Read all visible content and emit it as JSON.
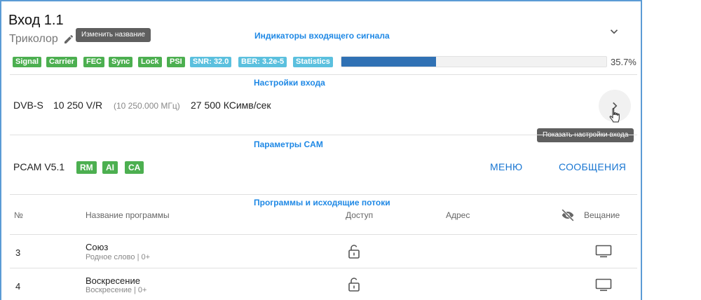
{
  "header": {
    "title": "Вход 1.1",
    "subtitle": "Триколор",
    "rename_tooltip": "Изменить название",
    "icons": {
      "edit": "pencil-icon",
      "expand": "chevron-down-icon"
    }
  },
  "annotations": {
    "signal_indicators": "Индикаторы входящего сигнала",
    "input_settings": "Настройки входа",
    "cam_params": "Параметры CAM",
    "programs": "Программы и исходящие потоки"
  },
  "signal": {
    "badges": [
      {
        "label": "Signal",
        "color": "#4caf50"
      },
      {
        "label": "Carrier",
        "color": "#4caf50"
      },
      {
        "label": "FEC",
        "color": "#4caf50"
      },
      {
        "label": "Sync",
        "color": "#4caf50"
      },
      {
        "label": "Lock",
        "color": "#4caf50"
      },
      {
        "label": "PSI",
        "color": "#4caf50"
      },
      {
        "label": "SNR: 32.0",
        "color": "#5bc0de"
      },
      {
        "label": "BER: 3.2e-5",
        "color": "#5bc0de"
      },
      {
        "label": "Statistics",
        "color": "#5bc0de"
      }
    ],
    "progress_fraction": 0.357,
    "progress_label": "35.7%"
  },
  "input": {
    "standard": "DVB-S",
    "frequency": "10 250 V/R",
    "frequency_mhz": "(10 250.000 МГц)",
    "symbol_rate": "27 500 КСимв/сек",
    "show_settings_tooltip": "Показать настройки входа"
  },
  "cam": {
    "name": "PCAM V5.1",
    "badges": [
      "RM",
      "AI",
      "CA"
    ],
    "menu_label": "МЕНЮ",
    "messages_label": "СООБЩЕНИЯ"
  },
  "table": {
    "headers": {
      "num": "№",
      "name": "Название программы",
      "access": "Доступ",
      "address": "Адрес",
      "broadcast": "Вещание"
    },
    "rows": [
      {
        "num": "3",
        "name": "Союз",
        "sub": "Родное слово | 0+",
        "access_icon": "unlock-icon",
        "broadcast_icon": "monitor-icon"
      },
      {
        "num": "4",
        "name": "Воскресение",
        "sub": "Воскресение | 0+",
        "access_icon": "unlock-icon",
        "broadcast_icon": "monitor-icon"
      }
    ]
  }
}
